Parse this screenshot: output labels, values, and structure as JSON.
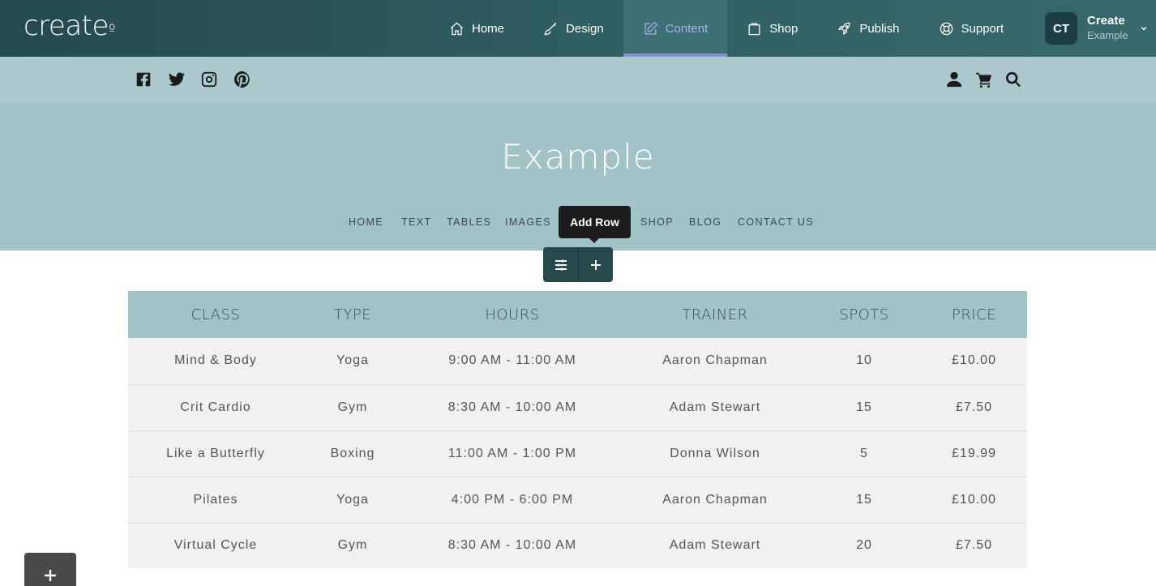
{
  "app": {
    "logo": "create",
    "logo_dot": "º",
    "nav": [
      {
        "label": "Home",
        "icon": "home-icon"
      },
      {
        "label": "Design",
        "icon": "brush-icon"
      },
      {
        "label": "Content",
        "icon": "edit-icon",
        "active": true
      },
      {
        "label": "Shop",
        "icon": "shopping-bag-icon"
      },
      {
        "label": "Publish",
        "icon": "rocket-icon"
      },
      {
        "label": "Support",
        "icon": "lifebuoy-icon"
      }
    ],
    "account": {
      "initials": "CT",
      "name": "Create",
      "site": "Example"
    }
  },
  "social": [
    "facebook-icon",
    "twitter-icon",
    "instagram-icon",
    "pinterest-icon"
  ],
  "header_actions": [
    "user-icon",
    "cart-icon",
    "search-icon"
  ],
  "site": {
    "title": "Example",
    "menu": [
      "HOME",
      "TEXT",
      "TABLES",
      "IMAGES",
      "SHOP",
      "BLOG",
      "CONTACT US"
    ]
  },
  "editor": {
    "tooltip": "Add Row"
  },
  "table": {
    "headers": [
      "CLASS",
      "TYPE",
      "HOURS",
      "TRAINER",
      "SPOTS",
      "PRICE"
    ],
    "rows": [
      [
        "Mind & Body",
        "Yoga",
        "9:00 AM - 11:00 AM",
        "Aaron Chapman",
        "10",
        "£10.00"
      ],
      [
        "Crit Cardio",
        "Gym",
        "8:30 AM - 10:00 AM",
        "Adam Stewart",
        "15",
        "£7.50"
      ],
      [
        "Like a Butterfly",
        "Boxing",
        "11:00 AM - 1:00 PM",
        "Donna Wilson",
        "5",
        "£19.99"
      ],
      [
        "Pilates",
        "Yoga",
        "4:00 PM - 6:00 PM",
        "Aaron Chapman",
        "15",
        "£10.00"
      ],
      [
        "Virtual Cycle",
        "Gym",
        "8:30 AM - 10:00 AM",
        "Adam Stewart",
        "20",
        "£7.50"
      ]
    ]
  },
  "colors": {
    "topbar": "#2f5e60",
    "active_underline": "#8b8fd6",
    "hero": "#a1c3c6",
    "socialbar": "#abc9cc"
  }
}
